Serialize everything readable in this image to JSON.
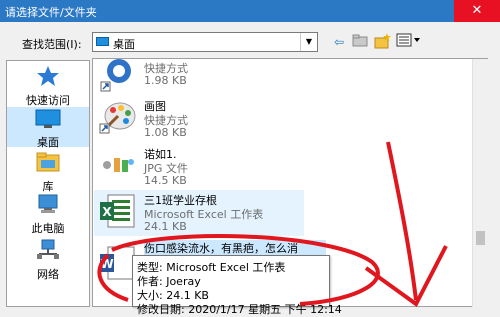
{
  "window": {
    "title": "请选择文件/文件夹",
    "close_glyph": "✕"
  },
  "lookin": {
    "label": "查找范围(I):",
    "value": "桌面"
  },
  "toolbar": {
    "back_glyph": "⇦",
    "up_glyph": "▲",
    "newfolder_glyph": "✱",
    "view_glyph": "▤"
  },
  "places": [
    {
      "label": "快速访问",
      "icon": "star-icon"
    },
    {
      "label": "桌面",
      "icon": "desktop-icon"
    },
    {
      "label": "库",
      "icon": "library-icon"
    },
    {
      "label": "此电脑",
      "icon": "computer-icon"
    },
    {
      "label": "网络",
      "icon": "network-icon"
    }
  ],
  "files": [
    {
      "name": "",
      "type": "快捷方式",
      "size": "1.98 KB",
      "icon": "shortcut-app-icon"
    },
    {
      "name": "画图",
      "type": "快捷方式",
      "size": "1.08 KB",
      "icon": "paint-icon"
    },
    {
      "name": "诺如1.",
      "type": "JPG 文件",
      "size": "14.5 KB",
      "icon": "jpg-image-icon"
    },
    {
      "name": "三1班学业存根",
      "type": "Microsoft Excel 工作表",
      "size": "24.1 KB",
      "icon": "excel-icon"
    },
    {
      "name": "伤口感染流水，有黑疤，怎么消",
      "type": "",
      "size": "",
      "icon": "word-icon"
    }
  ],
  "tooltip": {
    "type_line": "类型: Microsoft Excel 工作表",
    "author_line": "作者: Joeray",
    "size_line": "大小: 24.1 KB",
    "date_line": "修改日期: 2020/1/17 星期五 下午 12:14"
  },
  "colors": {
    "titlebar": "#2b78c5",
    "close": "#e81123",
    "selection": "#cce8ff",
    "hover": "#e5f3ff",
    "annotation": "#e0171e"
  }
}
